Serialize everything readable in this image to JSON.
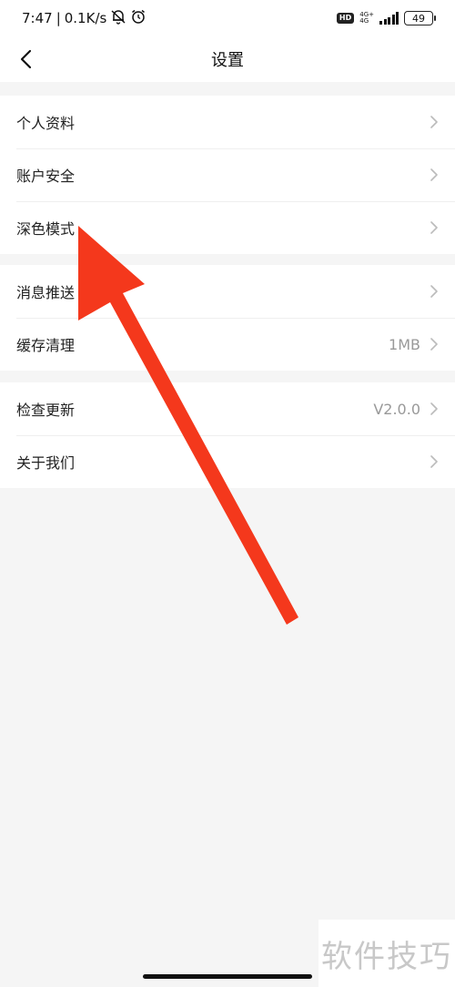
{
  "status_bar": {
    "time": "7:47",
    "net_speed": "0.1K/s",
    "hd": "HD",
    "net_type": "4G+",
    "net_sub": "4G",
    "battery": "49"
  },
  "header": {
    "title": "设置",
    "back_icon": "chevron-left-icon"
  },
  "sections": [
    {
      "items": [
        {
          "label": "个人资料",
          "value": ""
        },
        {
          "label": "账户安全",
          "value": ""
        },
        {
          "label": "深色模式",
          "value": ""
        }
      ]
    },
    {
      "items": [
        {
          "label": "消息推送",
          "value": ""
        },
        {
          "label": "缓存清理",
          "value": "1MB"
        }
      ]
    },
    {
      "items": [
        {
          "label": "检查更新",
          "value": "V2.0.0"
        },
        {
          "label": "关于我们",
          "value": ""
        }
      ]
    }
  ],
  "annotation": {
    "color": "#f4381c"
  },
  "watermark": "软件技巧"
}
